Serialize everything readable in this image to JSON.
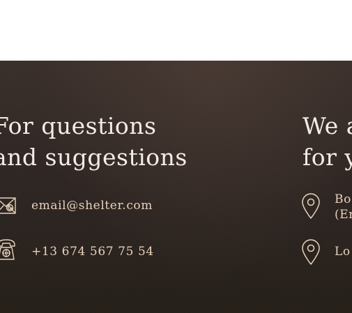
{
  "footer": {
    "contact_heading": {
      "line1": "For questions",
      "line2": "and suggestions"
    },
    "email": "email@shelter.com",
    "phone": "+13 674 567 75 54",
    "location_heading": {
      "line1": "We a",
      "line2": "for y"
    },
    "address_1": {
      "line1": "Bo",
      "line2": "(Er"
    },
    "address_2": "Lo",
    "icons": {
      "email": "envelope-icon",
      "phone": "telephone-icon",
      "location": "map-pin-icon"
    },
    "colors": {
      "background": "#2d2522",
      "heading_text": "#f2ece6",
      "detail_text": "#e9d3bc",
      "icon_stroke": "#e9d3bc"
    }
  }
}
